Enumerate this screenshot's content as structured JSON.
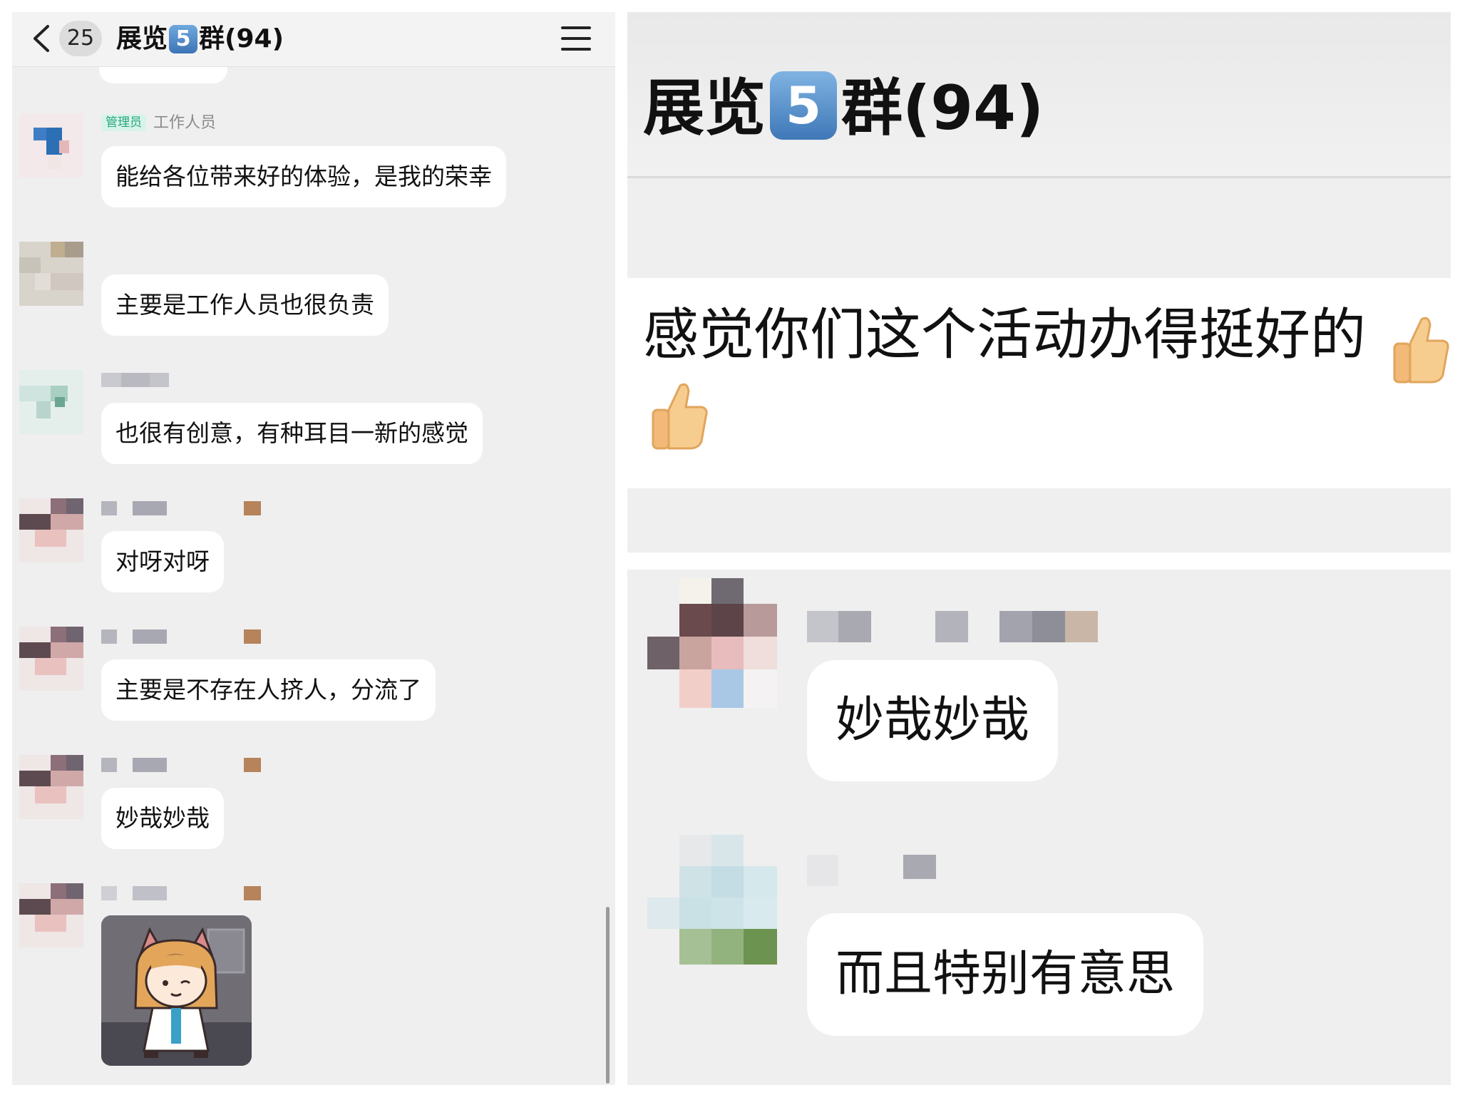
{
  "header": {
    "back_count": "25",
    "title_prefix": "展览",
    "title_badge": "5",
    "title_suffix": "群(94)"
  },
  "messages": [
    {
      "badge": "管理员",
      "sender": "工作人员",
      "text": "能给各位带来好的体验，是我的荣幸"
    },
    {
      "text": "主要是工作人员也很负责"
    },
    {
      "text": "也很有创意，有种耳目一新的感觉"
    },
    {
      "text": "对呀对呀"
    },
    {
      "text": "主要是不存在人挤人，分流了"
    },
    {
      "text": "妙哉妙哉"
    },
    {
      "type": "sticker",
      "description": "cat-ear-girl-sticker"
    }
  ],
  "zoom": {
    "title_prefix": "展览",
    "title_badge": "5",
    "title_suffix": "群(94)",
    "message_text": "感觉你们这个活动办得挺好的",
    "reply_1": "妙哉妙哉",
    "reply_2": "而且特别有意思"
  },
  "colors": {
    "chat_background": "#efefef",
    "bubble": "#ffffff",
    "admin_badge_bg": "#d9f3ea",
    "admin_badge_text": "#26a87a",
    "title_badge": "#3d74b6"
  },
  "icons": [
    "chevron-left-icon",
    "menu-icon",
    "thumbs-up-icon"
  ]
}
